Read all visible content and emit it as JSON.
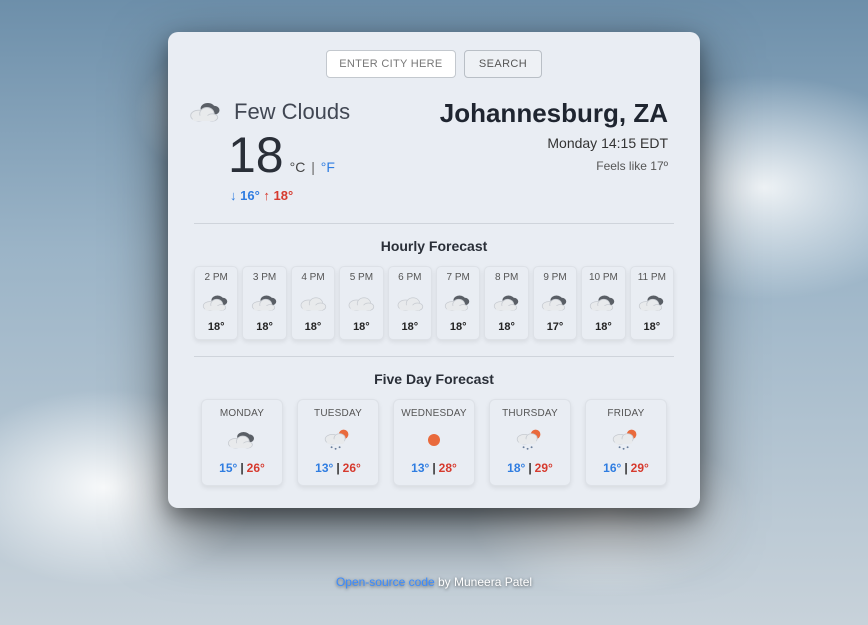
{
  "search": {
    "placeholder": "ENTER CITY HERE",
    "button": "SEARCH"
  },
  "current": {
    "condition": "Few Clouds",
    "temp": "18",
    "unit_c": "°C",
    "unit_f": "°F",
    "low": "16°",
    "high": "18°",
    "city": "Johannesburg, ZA",
    "datetime": "Monday 14:15 EDT",
    "feels": "Feels like 17º",
    "icon": "cloud-dark"
  },
  "hourly_title": "Hourly Forecast",
  "hourly": [
    {
      "time": "2 PM",
      "icon": "cloud-dark",
      "temp": "18°"
    },
    {
      "time": "3 PM",
      "icon": "cloud-dark",
      "temp": "18°"
    },
    {
      "time": "4 PM",
      "icon": "cloud",
      "temp": "18°"
    },
    {
      "time": "5 PM",
      "icon": "cloud",
      "temp": "18°"
    },
    {
      "time": "6 PM",
      "icon": "cloud",
      "temp": "18°"
    },
    {
      "time": "7 PM",
      "icon": "cloud-dark",
      "temp": "18°"
    },
    {
      "time": "8 PM",
      "icon": "cloud-dark",
      "temp": "18°"
    },
    {
      "time": "9 PM",
      "icon": "cloud-dark",
      "temp": "17°"
    },
    {
      "time": "10 PM",
      "icon": "cloud-dark",
      "temp": "18°"
    },
    {
      "time": "11 PM",
      "icon": "cloud-dark",
      "temp": "18°"
    }
  ],
  "daily_title": "Five Day Forecast",
  "daily": [
    {
      "name": "MONDAY",
      "icon": "cloud-dark",
      "low": "15°",
      "high": "26°"
    },
    {
      "name": "TUESDAY",
      "icon": "rain-sun",
      "low": "13°",
      "high": "26°"
    },
    {
      "name": "WEDNESDAY",
      "icon": "sun",
      "low": "13°",
      "high": "28°"
    },
    {
      "name": "THURSDAY",
      "icon": "rain-sun",
      "low": "18°",
      "high": "29°"
    },
    {
      "name": "FRIDAY",
      "icon": "rain-sun",
      "low": "16°",
      "high": "29°"
    }
  ],
  "footer": {
    "link": "Open-source code",
    "by": " by Muneera Patel"
  }
}
